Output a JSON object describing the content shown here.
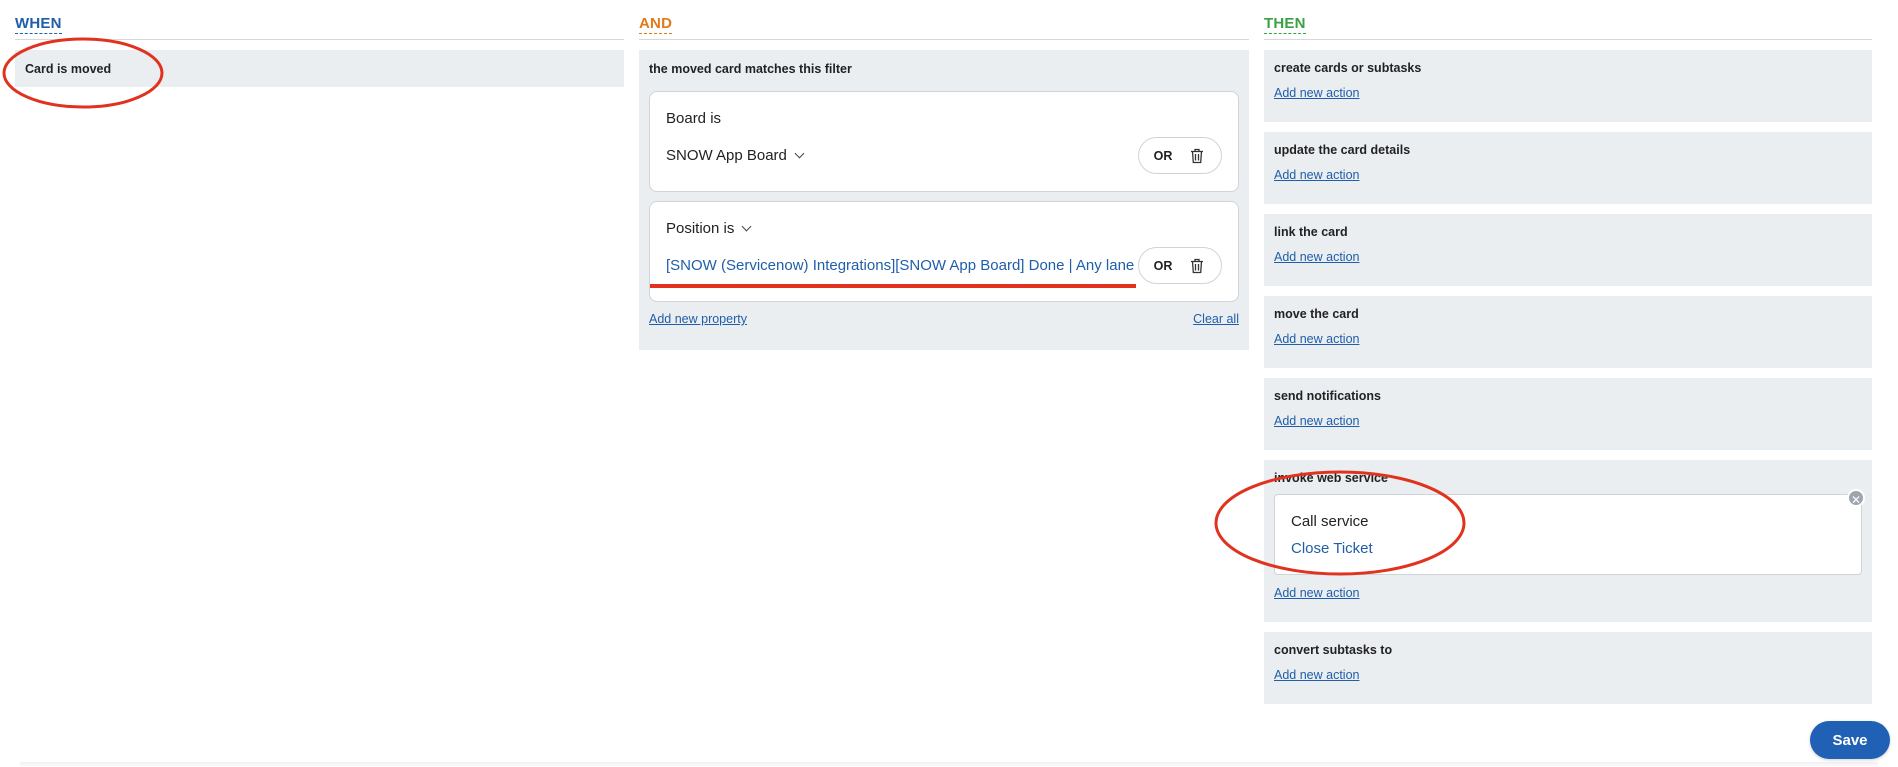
{
  "when": {
    "header": "WHEN",
    "trigger": "Card is moved"
  },
  "and": {
    "header": "AND",
    "panel_title": "the moved card matches this filter",
    "filters": [
      {
        "label": "Board is",
        "value": "SNOW App Board",
        "or_label": "OR"
      },
      {
        "label": "Position is",
        "value": "[SNOW (Servicenow) Integrations][SNOW App Board] Done | Any lane",
        "or_label": "OR"
      }
    ],
    "add_property": "Add new property",
    "clear_all": "Clear all"
  },
  "then": {
    "header": "THEN",
    "add_action_label": "Add new action",
    "sections": [
      {
        "title": "create cards or subtasks",
        "add_action": "Add new action"
      },
      {
        "title": "update the card details",
        "add_action": "Add new action"
      },
      {
        "title": "link the card",
        "add_action": "Add new action"
      },
      {
        "title": "move the card",
        "add_action": "Add new action"
      },
      {
        "title": "send notifications",
        "add_action": "Add new action"
      },
      {
        "title": "invoke web service",
        "add_action": "Add new action",
        "service_label": "Call service",
        "service_value": "Close Ticket"
      },
      {
        "title": "convert subtasks to",
        "add_action": "Add new action"
      }
    ]
  },
  "save_label": "Save",
  "colors": {
    "when": "#1f5ea8",
    "and": "#e07b1a",
    "then": "#3aa145",
    "link": "#1f5ea8",
    "panel_bg": "#ebeef1",
    "save_bg": "#2060b5",
    "annotation_red": "#e0321e"
  }
}
